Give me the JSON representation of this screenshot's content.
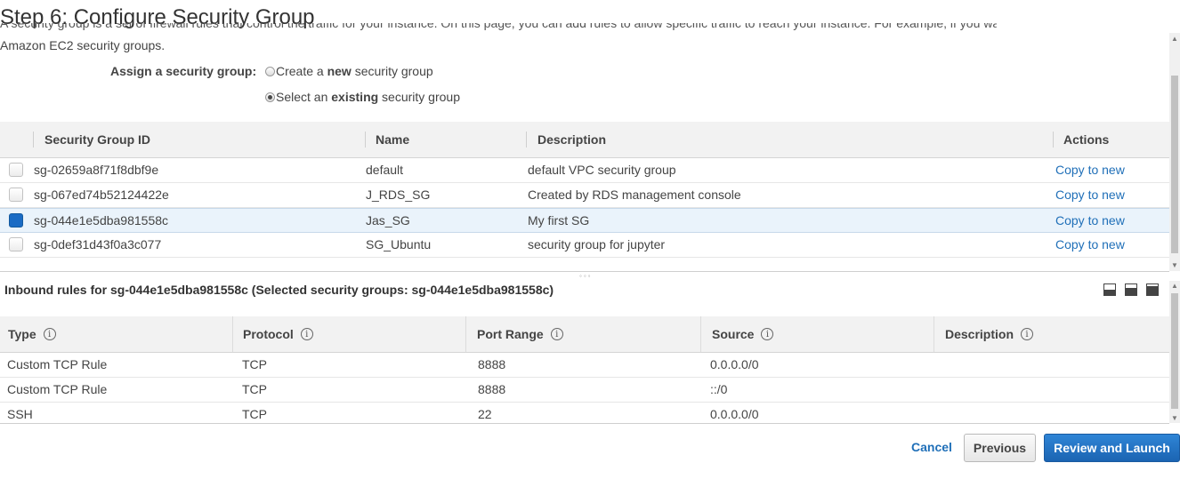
{
  "page": {
    "title": "Step 6: Configure Security Group",
    "intro_cut_text": "A security group is a set of firewall rules that control the traffic for your instance. On this page, you can add rules to allow specific traffic to reach your instance. For example, if you want to set up a web",
    "intro_line": "Amazon EC2 security groups."
  },
  "assign": {
    "label": "Assign a security group:",
    "options": [
      {
        "pre": "Create a ",
        "bold": "new",
        "post": " security group",
        "selected": false
      },
      {
        "pre": "Select an ",
        "bold": "existing",
        "post": " security group",
        "selected": true
      }
    ]
  },
  "sg_table": {
    "headers": {
      "id": "Security Group ID",
      "name": "Name",
      "description": "Description",
      "actions": "Actions"
    },
    "rows": [
      {
        "id": "sg-02659a8f71f8dbf9e",
        "name": "default",
        "description": "default VPC security group",
        "action": "Copy to new",
        "selected": false
      },
      {
        "id": "sg-067ed74b52124422e",
        "name": "J_RDS_SG",
        "description": "Created by RDS management console",
        "action": "Copy to new",
        "selected": false
      },
      {
        "id": "sg-044e1e5dba981558c",
        "name": "Jas_SG",
        "description": "My first SG",
        "action": "Copy to new",
        "selected": true
      },
      {
        "id": "sg-0def31d43f0a3c077",
        "name": "SG_Ubuntu",
        "description": "security group for jupyter",
        "action": "Copy to new",
        "selected": false
      }
    ]
  },
  "inbound": {
    "title": "Inbound rules for sg-044e1e5dba981558c (Selected security groups: sg-044e1e5dba981558c)",
    "headers": {
      "type": "Type",
      "protocol": "Protocol",
      "port_range": "Port Range",
      "source": "Source",
      "description": "Description"
    },
    "info_glyph": "i",
    "rows": [
      {
        "type": "Custom TCP Rule",
        "protocol": "TCP",
        "port_range": "8888",
        "source": "0.0.0.0/0",
        "description": ""
      },
      {
        "type": "Custom TCP Rule",
        "protocol": "TCP",
        "port_range": "8888",
        "source": "::/0",
        "description": ""
      },
      {
        "type": "SSH",
        "protocol": "TCP",
        "port_range": "22",
        "source": "0.0.0.0/0",
        "description": ""
      }
    ]
  },
  "footer": {
    "cancel": "Cancel",
    "previous": "Previous",
    "review_launch": "Review and Launch"
  },
  "colors": {
    "link": "#1f6fb8",
    "primary_button": "#1b64b2",
    "selected_row": "#eaf3fb",
    "header_bg": "#f2f2f2"
  }
}
